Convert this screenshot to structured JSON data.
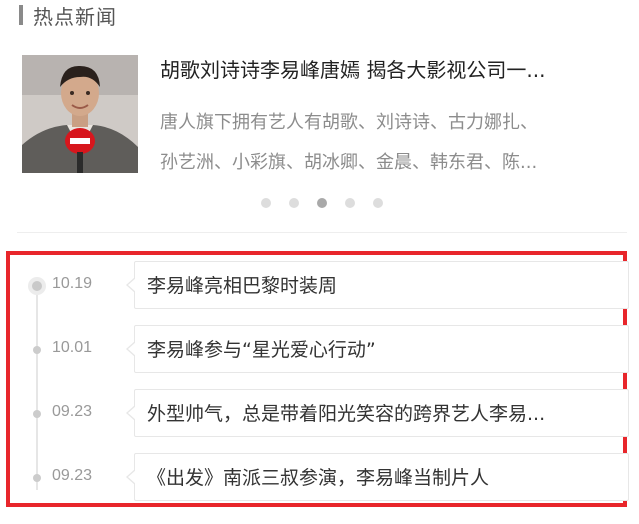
{
  "section": {
    "title": "热点新闻"
  },
  "featured": {
    "title": "胡歌刘诗诗李易峰唐嫣 揭各大影视公司一...",
    "summary_lines": [
      "唐人旗下拥有艺人有胡歌、刘诗诗、古力娜扎、",
      "孙艺洲、小彩旗、胡冰卿、金晨、韩东君、陈..."
    ]
  },
  "pager": {
    "count": 5,
    "active_index": 2
  },
  "timeline": [
    {
      "date": "10.19",
      "text": "李易峰亮相巴黎时装周"
    },
    {
      "date": "10.01",
      "text": "李易峰参与“星光爱心行动”"
    },
    {
      "date": "09.23",
      "text": "外型帅气，总是带着阳光笑容的跨界艺人李易..."
    },
    {
      "date": "09.23",
      "text": "《出发》南派三叔参演，李易峰当制片人"
    }
  ],
  "colors": {
    "highlight_border": "#e8262b",
    "microphone": "#d7161d"
  }
}
